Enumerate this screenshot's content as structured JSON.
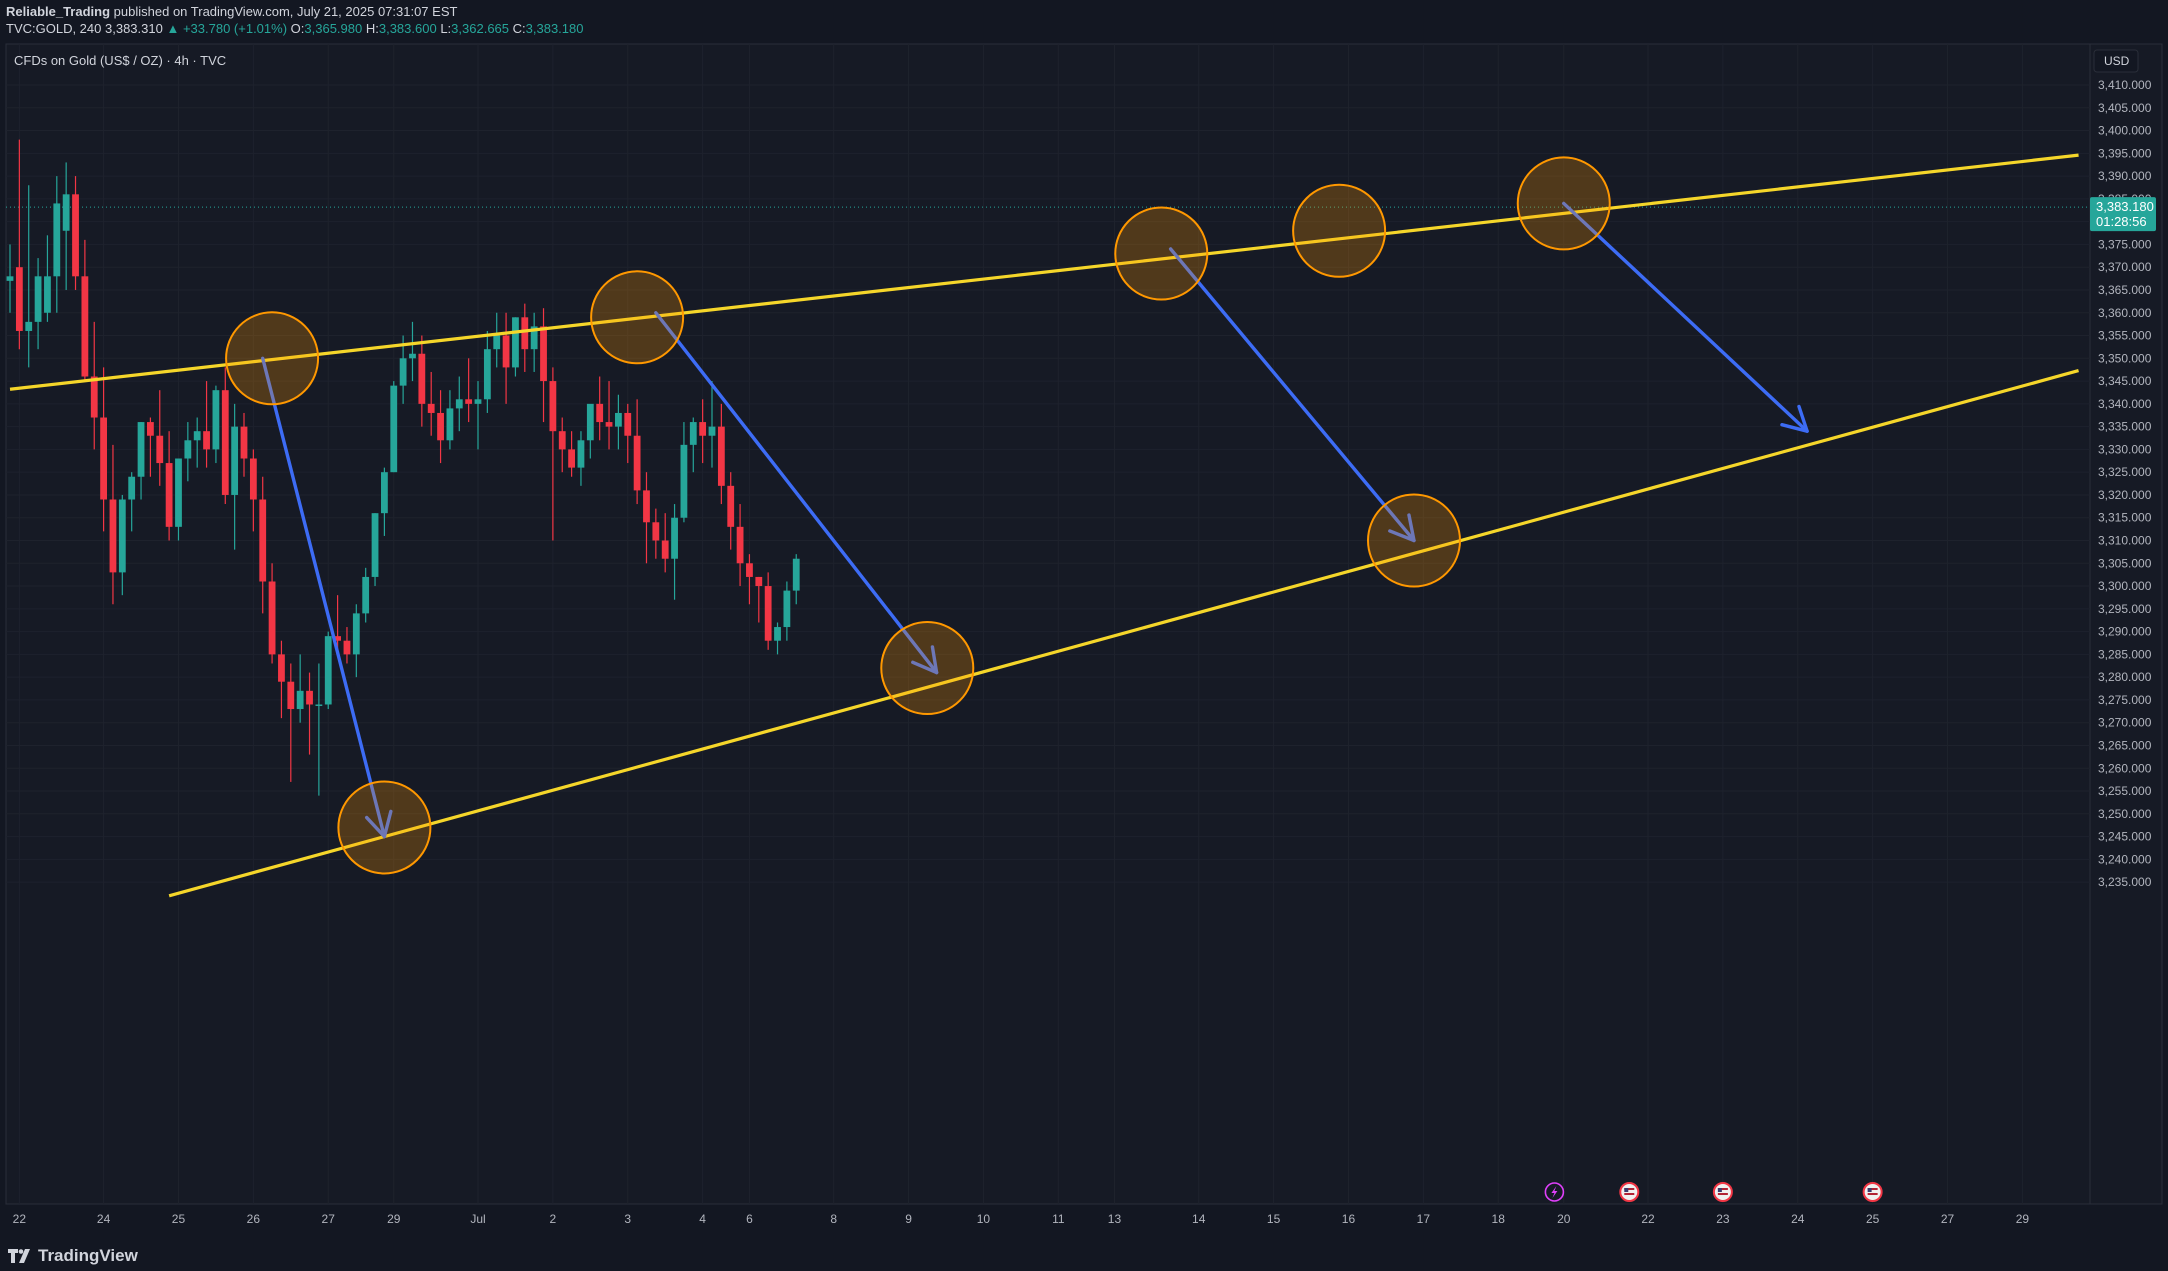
{
  "header": {
    "author": "Reliable_Trading",
    "published_text": "published on TradingView.com, July 21, 2025 07:31:07 EST",
    "symbol": "TVC:GOLD, 240",
    "last": "3,383.310",
    "change": "▲ +33.780 (+1.01%)",
    "o_label": "O:",
    "o": "3,365.980",
    "h_label": "H:",
    "h": "3,383.600",
    "l_label": "L:",
    "l": "3,362.665",
    "c_label": "C:",
    "c": "3,383.180"
  },
  "chart_title": "CFDs on Gold (US$ / OZ) · 4h · TVC",
  "currency_label": "USD",
  "price_tag": {
    "price": "3,383.180",
    "countdown": "01:28:56"
  },
  "footer": {
    "brand": "TradingView"
  },
  "colors": {
    "background": "#131722",
    "panel": "#161a25",
    "grid": "#1e222d",
    "up": "#26a69a",
    "down": "#f23645",
    "trendline": "#f5d62a",
    "arrow": "#3d6cf5",
    "marker": "#ff9800"
  },
  "chart_data": {
    "type": "candlestick",
    "y_ticks": [
      3235,
      3240,
      3245,
      3250,
      3255,
      3260,
      3265,
      3270,
      3275,
      3280,
      3285,
      3290,
      3295,
      3300,
      3305,
      3310,
      3315,
      3320,
      3325,
      3330,
      3335,
      3340,
      3345,
      3350,
      3355,
      3360,
      3365,
      3370,
      3375,
      3380,
      3385,
      3390,
      3395,
      3400,
      3405,
      3410
    ],
    "y_tick_labels": [
      "3,235.000",
      "3,240.000",
      "3,245.000",
      "3,250.000",
      "3,255.000",
      "3,260.000",
      "3,265.000",
      "3,270.000",
      "3,275.000",
      "3,280.000",
      "3,285.000",
      "3,290.000",
      "3,295.000",
      "3,300.000",
      "3,305.000",
      "3,310.000",
      "3,315.000",
      "3,320.000",
      "3,325.000",
      "3,330.000",
      "3,335.000",
      "3,340.000",
      "3,345.000",
      "3,350.000",
      "3,355.000",
      "3,360.000",
      "3,365.000",
      "3,370.000",
      "3,375.000",
      "3,380.000",
      "3,385.000",
      "3,390.000",
      "3,395.000",
      "3,400.000",
      "3,405.000",
      "3,410.000"
    ],
    "ylim": [
      3232,
      3414
    ],
    "x_ticks": [
      {
        "label": "22",
        "bar": 1
      },
      {
        "label": "24",
        "bar": 10
      },
      {
        "label": "25",
        "bar": 18
      },
      {
        "label": "26",
        "bar": 26
      },
      {
        "label": "27",
        "bar": 34
      },
      {
        "label": "29",
        "bar": 41
      },
      {
        "label": "Jul",
        "bar": 50
      },
      {
        "label": "2",
        "bar": 58
      },
      {
        "label": "3",
        "bar": 66
      },
      {
        "label": "4",
        "bar": 74
      },
      {
        "label": "6",
        "bar": 79
      },
      {
        "label": "8",
        "bar": 88
      },
      {
        "label": "9",
        "bar": 96
      },
      {
        "label": "10",
        "bar": 104
      },
      {
        "label": "11",
        "bar": 112
      },
      {
        "label": "13",
        "bar": 118
      },
      {
        "label": "14",
        "bar": 127
      },
      {
        "label": "15",
        "bar": 135
      },
      {
        "label": "16",
        "bar": 143
      },
      {
        "label": "17",
        "bar": 151
      },
      {
        "label": "18",
        "bar": 159
      },
      {
        "label": "20",
        "bar": 166
      },
      {
        "label": "22",
        "bar": 175
      },
      {
        "label": "23",
        "bar": 183
      },
      {
        "label": "24",
        "bar": 191
      },
      {
        "label": "25",
        "bar": 199
      },
      {
        "label": "27",
        "bar": 207
      },
      {
        "label": "29",
        "bar": 215
      }
    ],
    "candles": [
      {
        "o": 3367,
        "h": 3375,
        "l": 3360,
        "c": 3368
      },
      {
        "o": 3370,
        "h": 3398,
        "l": 3352,
        "c": 3356
      },
      {
        "o": 3356,
        "h": 3388,
        "l": 3348,
        "c": 3358
      },
      {
        "o": 3358,
        "h": 3372,
        "l": 3352,
        "c": 3368
      },
      {
        "o": 3360,
        "h": 3377,
        "l": 3358,
        "c": 3368
      },
      {
        "o": 3368,
        "h": 3390,
        "l": 3360,
        "c": 3384
      },
      {
        "o": 3378,
        "h": 3393,
        "l": 3365,
        "c": 3386
      },
      {
        "o": 3386,
        "h": 3390,
        "l": 3365,
        "c": 3368
      },
      {
        "o": 3368,
        "h": 3376,
        "l": 3345,
        "c": 3346
      },
      {
        "o": 3346,
        "h": 3358,
        "l": 3330,
        "c": 3337
      },
      {
        "o": 3337,
        "h": 3348,
        "l": 3312,
        "c": 3319
      },
      {
        "o": 3319,
        "h": 3331,
        "l": 3296,
        "c": 3303
      },
      {
        "o": 3303,
        "h": 3320,
        "l": 3298,
        "c": 3319
      },
      {
        "o": 3319,
        "h": 3325,
        "l": 3312,
        "c": 3324
      },
      {
        "o": 3324,
        "h": 3336,
        "l": 3319,
        "c": 3336
      },
      {
        "o": 3336,
        "h": 3337,
        "l": 3324,
        "c": 3333
      },
      {
        "o": 3333,
        "h": 3343,
        "l": 3322,
        "c": 3327
      },
      {
        "o": 3327,
        "h": 3334,
        "l": 3310,
        "c": 3313
      },
      {
        "o": 3313,
        "h": 3328,
        "l": 3310,
        "c": 3328
      },
      {
        "o": 3328,
        "h": 3336,
        "l": 3323,
        "c": 3332
      },
      {
        "o": 3332,
        "h": 3337,
        "l": 3326,
        "c": 3334
      },
      {
        "o": 3334,
        "h": 3345,
        "l": 3326,
        "c": 3330
      },
      {
        "o": 3330,
        "h": 3344,
        "l": 3327,
        "c": 3343
      },
      {
        "o": 3343,
        "h": 3348,
        "l": 3318,
        "c": 3320
      },
      {
        "o": 3320,
        "h": 3340,
        "l": 3308,
        "c": 3335
      },
      {
        "o": 3335,
        "h": 3338,
        "l": 3324,
        "c": 3328
      },
      {
        "o": 3328,
        "h": 3330,
        "l": 3312,
        "c": 3319
      },
      {
        "o": 3319,
        "h": 3324,
        "l": 3294,
        "c": 3301
      },
      {
        "o": 3301,
        "h": 3305,
        "l": 3283,
        "c": 3285
      },
      {
        "o": 3285,
        "h": 3288,
        "l": 3271,
        "c": 3279
      },
      {
        "o": 3279,
        "h": 3283,
        "l": 3257,
        "c": 3273
      },
      {
        "o": 3273,
        "h": 3285,
        "l": 3270,
        "c": 3277
      },
      {
        "o": 3277,
        "h": 3281,
        "l": 3263,
        "c": 3274
      },
      {
        "o": 3274,
        "h": 3283,
        "l": 3254,
        "c": 3274
      },
      {
        "o": 3274,
        "h": 3290,
        "l": 3273,
        "c": 3289
      },
      {
        "o": 3289,
        "h": 3298,
        "l": 3285,
        "c": 3288
      },
      {
        "o": 3288,
        "h": 3291,
        "l": 3283,
        "c": 3285
      },
      {
        "o": 3285,
        "h": 3296,
        "l": 3280,
        "c": 3294
      },
      {
        "o": 3294,
        "h": 3304,
        "l": 3292,
        "c": 3302
      },
      {
        "o": 3302,
        "h": 3316,
        "l": 3300,
        "c": 3316
      },
      {
        "o": 3316,
        "h": 3326,
        "l": 3311,
        "c": 3325
      },
      {
        "o": 3325,
        "h": 3345,
        "l": 3325,
        "c": 3344
      },
      {
        "o": 3344,
        "h": 3355,
        "l": 3340,
        "c": 3350
      },
      {
        "o": 3350,
        "h": 3358,
        "l": 3345,
        "c": 3351
      },
      {
        "o": 3351,
        "h": 3355,
        "l": 3335,
        "c": 3340
      },
      {
        "o": 3340,
        "h": 3347,
        "l": 3333,
        "c": 3338
      },
      {
        "o": 3338,
        "h": 3343,
        "l": 3327,
        "c": 3332
      },
      {
        "o": 3332,
        "h": 3343,
        "l": 3330,
        "c": 3339
      },
      {
        "o": 3339,
        "h": 3346,
        "l": 3334,
        "c": 3341
      },
      {
        "o": 3341,
        "h": 3350,
        "l": 3336,
        "c": 3340
      },
      {
        "o": 3340,
        "h": 3345,
        "l": 3330,
        "c": 3341
      },
      {
        "o": 3341,
        "h": 3356,
        "l": 3338,
        "c": 3352
      },
      {
        "o": 3352,
        "h": 3360,
        "l": 3348,
        "c": 3355
      },
      {
        "o": 3355,
        "h": 3360,
        "l": 3340,
        "c": 3348
      },
      {
        "o": 3348,
        "h": 3359,
        "l": 3346,
        "c": 3359
      },
      {
        "o": 3359,
        "h": 3362,
        "l": 3347,
        "c": 3352
      },
      {
        "o": 3352,
        "h": 3360,
        "l": 3347,
        "c": 3357
      },
      {
        "o": 3357,
        "h": 3361,
        "l": 3336,
        "c": 3345
      },
      {
        "o": 3345,
        "h": 3348,
        "l": 3310,
        "c": 3334
      },
      {
        "o": 3334,
        "h": 3337,
        "l": 3325,
        "c": 3330
      },
      {
        "o": 3330,
        "h": 3334,
        "l": 3324,
        "c": 3326
      },
      {
        "o": 3326,
        "h": 3334,
        "l": 3322,
        "c": 3332
      },
      {
        "o": 3332,
        "h": 3338,
        "l": 3328,
        "c": 3340
      },
      {
        "o": 3340,
        "h": 3346,
        "l": 3332,
        "c": 3336
      },
      {
        "o": 3336,
        "h": 3345,
        "l": 3330,
        "c": 3335
      },
      {
        "o": 3335,
        "h": 3342,
        "l": 3330,
        "c": 3338
      },
      {
        "o": 3338,
        "h": 3340,
        "l": 3327,
        "c": 3333
      },
      {
        "o": 3333,
        "h": 3341,
        "l": 3318,
        "c": 3321
      },
      {
        "o": 3321,
        "h": 3325,
        "l": 3305,
        "c": 3314
      },
      {
        "o": 3314,
        "h": 3317,
        "l": 3306,
        "c": 3310
      },
      {
        "o": 3310,
        "h": 3316,
        "l": 3303,
        "c": 3306
      },
      {
        "o": 3306,
        "h": 3318,
        "l": 3297,
        "c": 3315
      },
      {
        "o": 3315,
        "h": 3336,
        "l": 3314,
        "c": 3331
      },
      {
        "o": 3331,
        "h": 3337,
        "l": 3325,
        "c": 3336
      },
      {
        "o": 3336,
        "h": 3341,
        "l": 3327,
        "c": 3333
      },
      {
        "o": 3333,
        "h": 3345,
        "l": 3326,
        "c": 3335
      },
      {
        "o": 3335,
        "h": 3340,
        "l": 3318,
        "c": 3322
      },
      {
        "o": 3322,
        "h": 3325,
        "l": 3308,
        "c": 3313
      },
      {
        "o": 3313,
        "h": 3318,
        "l": 3300,
        "c": 3305
      },
      {
        "o": 3305,
        "h": 3307,
        "l": 3296,
        "c": 3302
      },
      {
        "o": 3302,
        "h": 3302,
        "l": 3292,
        "c": 3300
      },
      {
        "o": 3300,
        "h": 3303,
        "l": 3286,
        "c": 3288
      },
      {
        "o": 3288,
        "h": 3292,
        "l": 3285,
        "c": 3291
      },
      {
        "o": 3291,
        "h": 3301,
        "l": 3288,
        "c": 3299
      },
      {
        "o": 3299,
        "h": 3307,
        "l": 3296,
        "c": 3306
      }
    ],
    "trendlines": [
      {
        "name": "upper-resistance",
        "from": {
          "bar": 0,
          "price": 3343.2
        },
        "to": {
          "bar": 221,
          "price": 3394.6
        }
      },
      {
        "name": "lower-support",
        "from": {
          "bar": 17,
          "price": 3232
        },
        "to": {
          "bar": 221,
          "price": 3347.3
        }
      }
    ],
    "projection_arrows": [
      {
        "from": {
          "bar": 27,
          "price": 3350
        },
        "to": {
          "bar": 40,
          "price": 3245
        }
      },
      {
        "from": {
          "bar": 69,
          "price": 3360
        },
        "to": {
          "bar": 99,
          "price": 3281
        }
      },
      {
        "from": {
          "bar": 124,
          "price": 3374
        },
        "to": {
          "bar": 150,
          "price": 3310
        }
      },
      {
        "from": {
          "bar": 166,
          "price": 3384
        },
        "to": {
          "bar": 192,
          "price": 3334
        }
      }
    ],
    "circles": [
      {
        "bar": 28,
        "price": 3350
      },
      {
        "bar": 40,
        "price": 3247
      },
      {
        "bar": 67,
        "price": 3359
      },
      {
        "bar": 98,
        "price": 3282
      },
      {
        "bar": 123,
        "price": 3373
      },
      {
        "bar": 142,
        "price": 3378
      },
      {
        "bar": 150,
        "price": 3310
      },
      {
        "bar": 166,
        "price": 3384
      }
    ],
    "event_icons": [
      {
        "bar": 165,
        "kind": "flash"
      },
      {
        "bar": 173,
        "kind": "us-flag"
      },
      {
        "bar": 183,
        "kind": "us-flag"
      },
      {
        "bar": 199,
        "kind": "us-flag"
      }
    ],
    "current_price": 3383.18
  }
}
